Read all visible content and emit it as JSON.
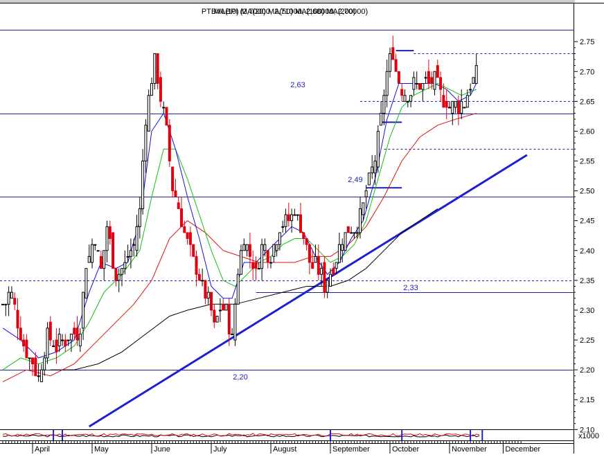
{
  "chart_data": {
    "type": "candlestick",
    "title": "PTBVLBPI (2,70000, 2,71000, 2,68000, 2,70000)",
    "overlay_title": "MA(10) MA(20) MA(50) MA(100) MA(200)",
    "volume_multiplier_label": "x1000",
    "ylim": [
      2.105,
      2.785
    ],
    "y_ticks": [
      "2.75",
      "2.70",
      "2.65",
      "2.60",
      "2.55",
      "2.50",
      "2.45",
      "2.40",
      "2.35",
      "2.30",
      "2.25",
      "2.20",
      "2.15",
      "2.10"
    ],
    "months": [
      "April",
      "May",
      "June",
      "July",
      "August",
      "September",
      "October",
      "November",
      "December"
    ],
    "annotations": [
      {
        "text": "2,63",
        "value": 2.63
      },
      {
        "text": "2,49",
        "value": 2.49
      },
      {
        "text": "2,33",
        "value": 2.33
      },
      {
        "text": "2,20",
        "value": 2.2
      }
    ],
    "horizontal_levels": [
      {
        "value": 2.77,
        "style": "solid"
      },
      {
        "value": 2.63,
        "style": "solid"
      },
      {
        "value": 2.49,
        "style": "solid"
      },
      {
        "value": 2.2,
        "style": "solid"
      },
      {
        "value": 2.35,
        "style": "dashed"
      },
      {
        "value": 2.33,
        "style": "solid",
        "from_day": 85,
        "to_day": 167
      },
      {
        "value": 2.73,
        "style": "dashed",
        "from_day": 138,
        "to_day": 167
      },
      {
        "value": 2.65,
        "style": "dashed",
        "from_day": 120,
        "to_day": 167
      },
      {
        "value": 2.57,
        "style": "dashed",
        "from_day": 128,
        "to_day": 167
      }
    ],
    "short_levels": [
      {
        "value": 2.735,
        "from_day": 132,
        "to_day": 138
      },
      {
        "value": 2.615,
        "from_day": 127,
        "to_day": 134
      },
      {
        "value": 2.505,
        "from_day": 122,
        "to_day": 134
      }
    ],
    "trendline": {
      "from": {
        "day": 29,
        "value": 2.105
      },
      "to": {
        "day": 176,
        "value": 2.56
      }
    },
    "close_path": [
      [
        0,
        2.31
      ],
      [
        3,
        2.33
      ],
      [
        6,
        2.26
      ],
      [
        9,
        2.22
      ],
      [
        12,
        2.19
      ],
      [
        15,
        2.26
      ],
      [
        18,
        2.24
      ],
      [
        21,
        2.25
      ],
      [
        24,
        2.26
      ],
      [
        26,
        2.27
      ],
      [
        28,
        2.38
      ],
      [
        31,
        2.42
      ],
      [
        33,
        2.37
      ],
      [
        35,
        2.44
      ],
      [
        38,
        2.36
      ],
      [
        41,
        2.38
      ],
      [
        44,
        2.41
      ],
      [
        46,
        2.47
      ],
      [
        48,
        2.62
      ],
      [
        51,
        2.72
      ],
      [
        53,
        2.66
      ],
      [
        55,
        2.6
      ],
      [
        57,
        2.51
      ],
      [
        60,
        2.45
      ],
      [
        62,
        2.41
      ],
      [
        65,
        2.37
      ],
      [
        67,
        2.34
      ],
      [
        69,
        2.32
      ],
      [
        71,
        2.27
      ],
      [
        73,
        2.3
      ],
      [
        75,
        2.3
      ],
      [
        77,
        2.25
      ],
      [
        79,
        2.37
      ],
      [
        81,
        2.42
      ],
      [
        83,
        2.39
      ],
      [
        85,
        2.36
      ],
      [
        87,
        2.41
      ],
      [
        90,
        2.39
      ],
      [
        93,
        2.44
      ],
      [
        96,
        2.45
      ],
      [
        98,
        2.47
      ],
      [
        100,
        2.44
      ],
      [
        103,
        2.38
      ],
      [
        106,
        2.37
      ],
      [
        108,
        2.34
      ],
      [
        110,
        2.36
      ],
      [
        112,
        2.39
      ],
      [
        115,
        2.43
      ],
      [
        117,
        2.44
      ],
      [
        119,
        2.44
      ],
      [
        121,
        2.47
      ],
      [
        123,
        2.52
      ],
      [
        125,
        2.55
      ],
      [
        127,
        2.62
      ],
      [
        129,
        2.7
      ],
      [
        131,
        2.73
      ],
      [
        133,
        2.68
      ],
      [
        136,
        2.66
      ],
      [
        138,
        2.68
      ],
      [
        141,
        2.68
      ],
      [
        143,
        2.68
      ],
      [
        145,
        2.69
      ],
      [
        147,
        2.66
      ],
      [
        149,
        2.65
      ],
      [
        151,
        2.64
      ],
      [
        153,
        2.64
      ],
      [
        155,
        2.65
      ],
      [
        157,
        2.68
      ],
      [
        159,
        2.7
      ]
    ],
    "ma10_path": [
      [
        0,
        2.27
      ],
      [
        6,
        2.25
      ],
      [
        12,
        2.22
      ],
      [
        18,
        2.23
      ],
      [
        24,
        2.25
      ],
      [
        29,
        2.33
      ],
      [
        33,
        2.38
      ],
      [
        38,
        2.37
      ],
      [
        42,
        2.38
      ],
      [
        46,
        2.45
      ],
      [
        50,
        2.6
      ],
      [
        54,
        2.63
      ],
      [
        58,
        2.57
      ],
      [
        62,
        2.49
      ],
      [
        66,
        2.42
      ],
      [
        70,
        2.34
      ],
      [
        74,
        2.32
      ],
      [
        77,
        2.32
      ],
      [
        81,
        2.38
      ],
      [
        85,
        2.38
      ],
      [
        89,
        2.4
      ],
      [
        93,
        2.42
      ],
      [
        97,
        2.44
      ],
      [
        101,
        2.43
      ],
      [
        105,
        2.39
      ],
      [
        109,
        2.36
      ],
      [
        113,
        2.38
      ],
      [
        117,
        2.42
      ],
      [
        121,
        2.45
      ],
      [
        125,
        2.52
      ],
      [
        129,
        2.62
      ],
      [
        133,
        2.68
      ],
      [
        137,
        2.68
      ],
      [
        141,
        2.68
      ],
      [
        145,
        2.68
      ],
      [
        149,
        2.67
      ],
      [
        153,
        2.65
      ],
      [
        157,
        2.66
      ],
      [
        159,
        2.68
      ]
    ],
    "ma20_path": [
      [
        0,
        2.2
      ],
      [
        6,
        2.22
      ],
      [
        12,
        2.21
      ],
      [
        18,
        2.22
      ],
      [
        24,
        2.24
      ],
      [
        29,
        2.28
      ],
      [
        34,
        2.33
      ],
      [
        40,
        2.36
      ],
      [
        46,
        2.4
      ],
      [
        50,
        2.49
      ],
      [
        54,
        2.57
      ],
      [
        58,
        2.57
      ],
      [
        62,
        2.52
      ],
      [
        66,
        2.46
      ],
      [
        70,
        2.4
      ],
      [
        74,
        2.35
      ],
      [
        78,
        2.34
      ],
      [
        82,
        2.36
      ],
      [
        86,
        2.38
      ],
      [
        90,
        2.39
      ],
      [
        94,
        2.41
      ],
      [
        98,
        2.42
      ],
      [
        102,
        2.42
      ],
      [
        106,
        2.4
      ],
      [
        110,
        2.38
      ],
      [
        114,
        2.39
      ],
      [
        118,
        2.41
      ],
      [
        122,
        2.45
      ],
      [
        126,
        2.52
      ],
      [
        130,
        2.59
      ],
      [
        134,
        2.64
      ],
      [
        138,
        2.66
      ],
      [
        142,
        2.67
      ],
      [
        146,
        2.68
      ],
      [
        150,
        2.67
      ],
      [
        154,
        2.66
      ],
      [
        159,
        2.67
      ]
    ],
    "ma50_path": [
      [
        0,
        2.18
      ],
      [
        8,
        2.2
      ],
      [
        16,
        2.19
      ],
      [
        24,
        2.21
      ],
      [
        30,
        2.24
      ],
      [
        38,
        2.28
      ],
      [
        44,
        2.31
      ],
      [
        50,
        2.35
      ],
      [
        56,
        2.42
      ],
      [
        62,
        2.45
      ],
      [
        68,
        2.43
      ],
      [
        74,
        2.4
      ],
      [
        80,
        2.39
      ],
      [
        86,
        2.38
      ],
      [
        92,
        2.38
      ],
      [
        98,
        2.38
      ],
      [
        104,
        2.39
      ],
      [
        110,
        2.39
      ],
      [
        116,
        2.41
      ],
      [
        122,
        2.44
      ],
      [
        128,
        2.49
      ],
      [
        134,
        2.55
      ],
      [
        140,
        2.59
      ],
      [
        146,
        2.61
      ],
      [
        152,
        2.62
      ],
      [
        159,
        2.63
      ]
    ],
    "ma100_path": [
      [
        16,
        2.2
      ],
      [
        24,
        2.2
      ],
      [
        32,
        2.21
      ],
      [
        40,
        2.23
      ],
      [
        48,
        2.26
      ],
      [
        56,
        2.29
      ],
      [
        62,
        2.3
      ],
      [
        70,
        2.31
      ],
      [
        78,
        2.31
      ],
      [
        86,
        2.32
      ],
      [
        94,
        2.33
      ],
      [
        102,
        2.34
      ],
      [
        110,
        2.34
      ],
      [
        116,
        2.35
      ],
      [
        122,
        2.37
      ],
      [
        128,
        2.4
      ],
      [
        134,
        2.43
      ],
      [
        140,
        2.45
      ],
      [
        146,
        2.47
      ]
    ],
    "volume_spikes": [
      17,
      20,
      110,
      134,
      157,
      161
    ]
  }
}
